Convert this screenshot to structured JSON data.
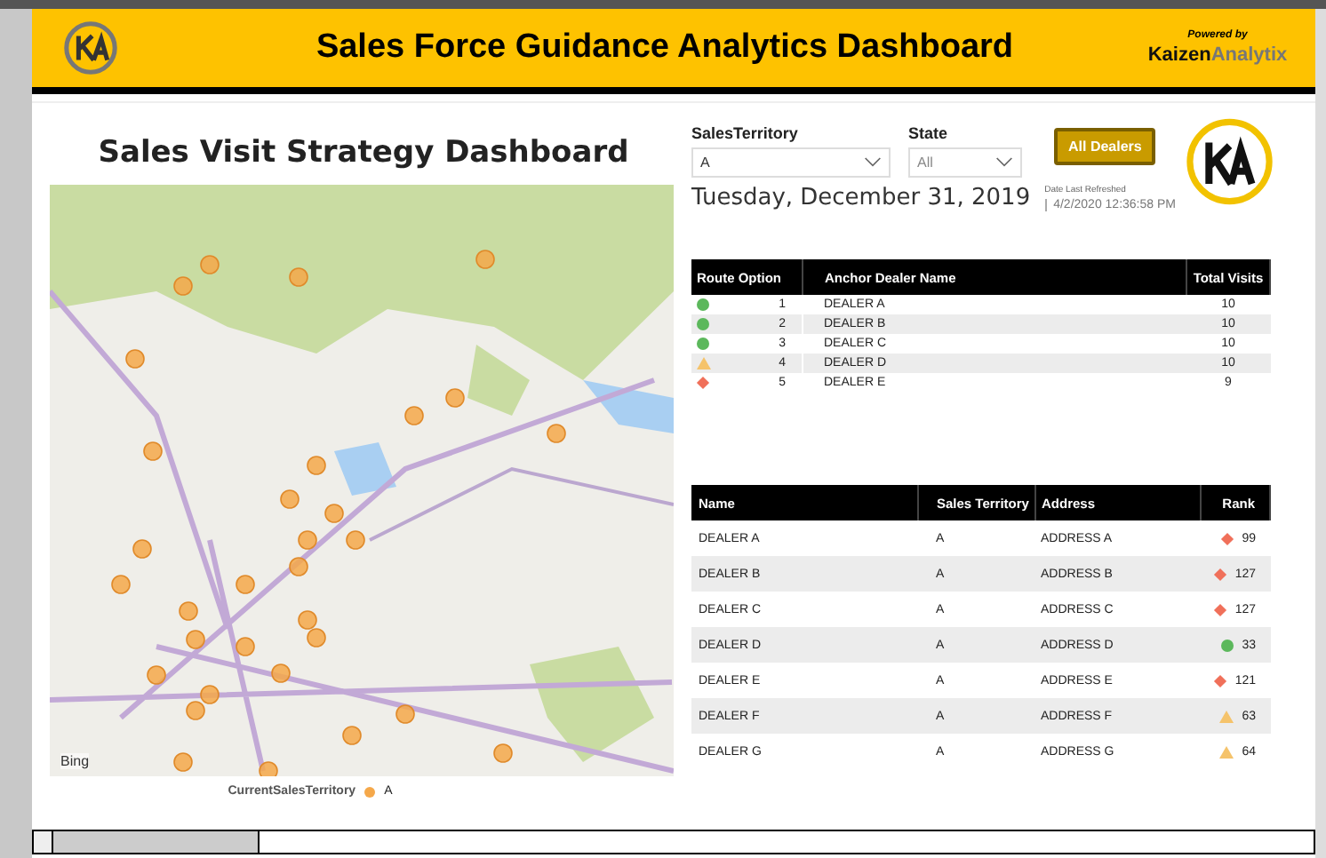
{
  "header": {
    "title": "Sales Force Guidance Analytics Dashboard",
    "powered_by": "Powered by",
    "brand_first": "Kaizen",
    "brand_second": "Analytix"
  },
  "map_panel": {
    "title": "Sales Visit Strategy Dashboard",
    "attribution": "Bing",
    "legend": {
      "label": "CurrentSalesTerritory",
      "color": "#f5a84a",
      "value": "A"
    }
  },
  "filters": [
    {
      "label": "SalesTerritory",
      "value": "A"
    },
    {
      "label": "State",
      "value": "All"
    }
  ],
  "all_dealers_button": "All Dealers",
  "date": "Tuesday, December 31, 2019",
  "refresh": {
    "label": "Date Last Refreshed",
    "value": "4/2/2020 12:36:58 PM"
  },
  "routes": {
    "columns": [
      "Route Option",
      "Anchor Dealer Name",
      "Total Visits"
    ],
    "rows": [
      {
        "kind": "circle",
        "color": "#5cb85c",
        "option": "1",
        "dealer": "DEALER A",
        "visits": "10"
      },
      {
        "kind": "circle",
        "color": "#5cb85c",
        "option": "2",
        "dealer": "DEALER B",
        "visits": "10"
      },
      {
        "kind": "circle",
        "color": "#5cb85c",
        "option": "3",
        "dealer": "DEALER C",
        "visits": "10"
      },
      {
        "kind": "triangle",
        "color": "#f5c36b",
        "option": "4",
        "dealer": "DEALER D",
        "visits": "10"
      },
      {
        "kind": "diamond",
        "color": "#f0705a",
        "option": "5",
        "dealer": "DEALER E",
        "visits": "9"
      }
    ]
  },
  "dealers": {
    "columns": [
      "Name",
      "Sales Territory",
      "Address",
      "Rank"
    ],
    "rows": [
      {
        "name": "DEALER A",
        "territory": "A",
        "address": "ADDRESS A",
        "kind": "diamond",
        "color": "#f0705a",
        "rank": "99"
      },
      {
        "name": "DEALER B",
        "territory": "A",
        "address": "ADDRESS B",
        "kind": "diamond",
        "color": "#f0705a",
        "rank": "127"
      },
      {
        "name": "DEALER C",
        "territory": "A",
        "address": "ADDRESS C",
        "kind": "diamond",
        "color": "#f0705a",
        "rank": "127"
      },
      {
        "name": "DEALER D",
        "territory": "A",
        "address": "ADDRESS D",
        "kind": "circle",
        "color": "#5cb85c",
        "rank": "33"
      },
      {
        "name": "DEALER E",
        "territory": "A",
        "address": "ADDRESS E",
        "kind": "diamond",
        "color": "#f0705a",
        "rank": "121"
      },
      {
        "name": "DEALER F",
        "territory": "A",
        "address": "ADDRESS F",
        "kind": "triangle",
        "color": "#f5c36b",
        "rank": "63"
      },
      {
        "name": "DEALER G",
        "territory": "A",
        "address": "ADDRESS G",
        "kind": "triangle",
        "color": "#f5c36b",
        "rank": "64"
      }
    ]
  }
}
